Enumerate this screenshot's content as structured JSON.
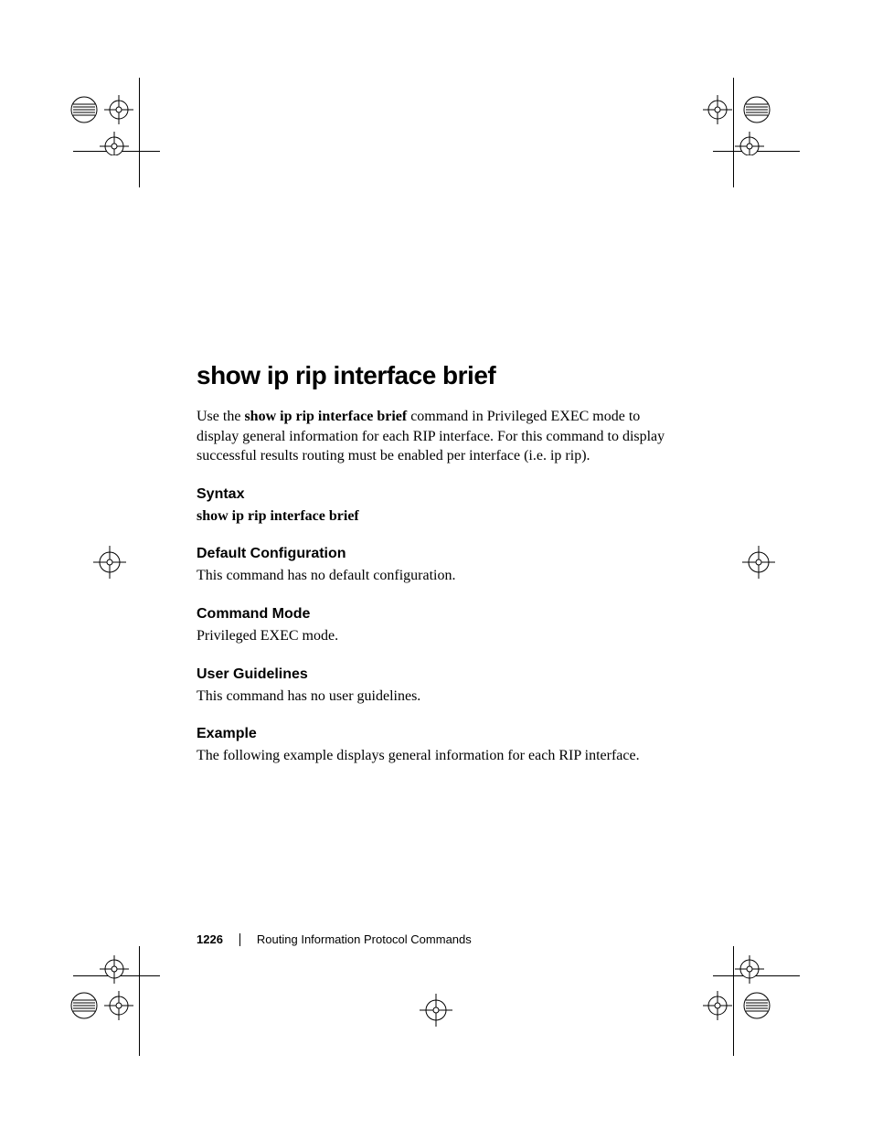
{
  "title": "show ip rip interface brief",
  "intro_prefix": "Use the ",
  "intro_cmd": "show ip rip interface brief",
  "intro_suffix": " command in Privileged EXEC mode to display general information for each RIP interface. For this command to display successful results routing must be enabled per interface (i.e. ip rip).",
  "syntax": {
    "heading": "Syntax",
    "body": "show ip rip interface brief"
  },
  "default_config": {
    "heading": "Default Configuration",
    "body": "This command has no default configuration."
  },
  "command_mode": {
    "heading": "Command Mode",
    "body": "Privileged EXEC mode."
  },
  "user_guidelines": {
    "heading": "User Guidelines",
    "body": "This command has no user guidelines."
  },
  "example": {
    "heading": "Example",
    "body": "The following example displays general information for each RIP interface."
  },
  "footer": {
    "page_number": "1226",
    "label": "Routing Information Protocol Commands"
  }
}
